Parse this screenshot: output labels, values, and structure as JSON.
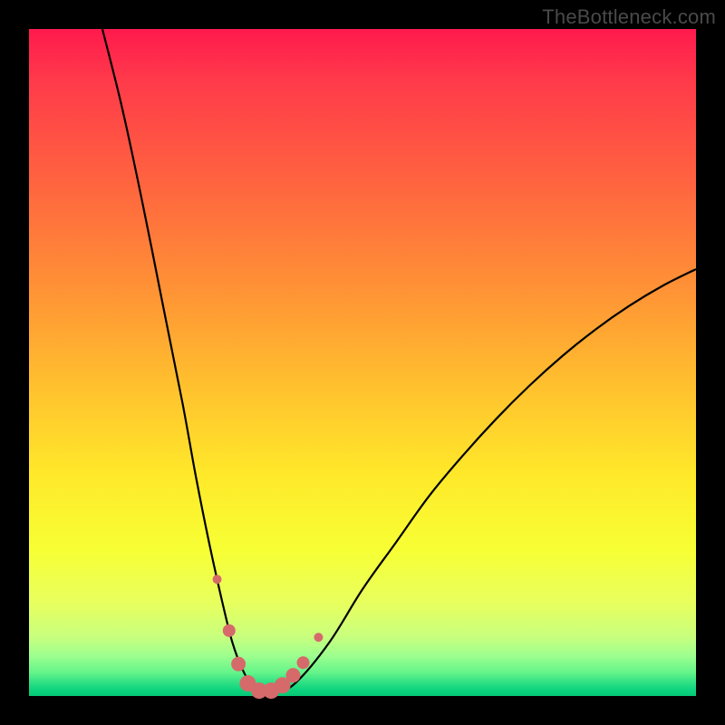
{
  "watermark": "TheBottleneck.com",
  "colors": {
    "frame": "#000000",
    "curve": "#000000",
    "marker_fill": "#d66a6a",
    "marker_stroke": "#c25e5e"
  },
  "chart_data": {
    "type": "line",
    "title": "",
    "xlabel": "",
    "ylabel": "",
    "xlim": [
      0,
      100
    ],
    "ylim": [
      0,
      100
    ],
    "note": "Axes are implicit (no tick labels shown). x ≈ component balance position, y ≈ bottleneck percentage. Values estimated from pixels.",
    "series": [
      {
        "name": "bottleneck-curve",
        "x": [
          11,
          14,
          17,
          20,
          23,
          25,
          27,
          29,
          30.5,
          32,
          33.5,
          35,
          37,
          40,
          45,
          50,
          55,
          60,
          65,
          70,
          75,
          80,
          85,
          90,
          95,
          100
        ],
        "y": [
          100,
          88,
          74,
          59,
          44,
          33,
          23,
          14,
          8,
          4,
          1.5,
          0.5,
          0.5,
          2,
          8,
          16,
          23,
          30,
          36,
          41.5,
          46.5,
          51,
          55,
          58.5,
          61.5,
          64
        ]
      }
    ],
    "markers": {
      "name": "highlight-dots",
      "points": [
        {
          "x": 28.2,
          "y": 17.5,
          "r": 5
        },
        {
          "x": 30.0,
          "y": 9.8,
          "r": 7
        },
        {
          "x": 31.4,
          "y": 4.8,
          "r": 8
        },
        {
          "x": 32.8,
          "y": 1.9,
          "r": 9
        },
        {
          "x": 34.5,
          "y": 0.8,
          "r": 9
        },
        {
          "x": 36.3,
          "y": 0.8,
          "r": 9
        },
        {
          "x": 38.0,
          "y": 1.6,
          "r": 9
        },
        {
          "x": 39.6,
          "y": 3.1,
          "r": 8
        },
        {
          "x": 41.1,
          "y": 5.0,
          "r": 7
        },
        {
          "x": 43.4,
          "y": 8.8,
          "r": 5
        }
      ]
    }
  }
}
